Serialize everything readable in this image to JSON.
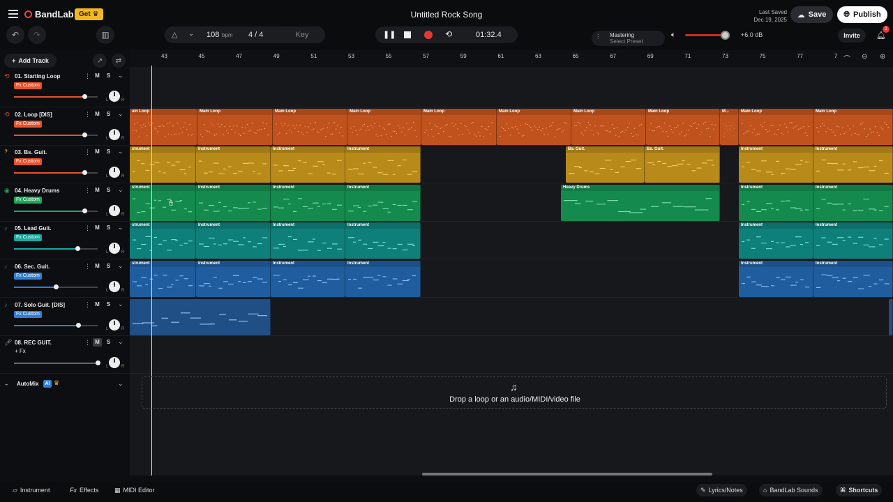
{
  "header": {
    "app_name": "BandLab",
    "get_label": "Get",
    "song_title": "Untitled Rock Song",
    "last_saved_label": "Last Saved",
    "last_saved_date": "Dec 19, 2025",
    "save_label": "Save",
    "publish_label": "Publish"
  },
  "toolbar": {
    "tempo": "108",
    "tempo_unit": "bpm",
    "time_signature": "4 / 4",
    "key_label": "Key",
    "time_display": "01:32.4",
    "mastering_label": "Mastering",
    "mastering_preset": "Select Preset",
    "volume_db": "+6.0 dB",
    "invite_label": "Invite",
    "notification_count": "1",
    "record_color": "#e53935"
  },
  "track_panel": {
    "add_track_label": "Add Track",
    "mute_label": "M",
    "solo_label": "S",
    "knob_left": "L",
    "knob_right": "R",
    "automix_label": "AutoMix",
    "automix_badge": "AI"
  },
  "tracks": [
    {
      "name": "01. Starting Loop",
      "fx": "Fx Custom",
      "fx_color": "#e8522b",
      "icon_color": "#e8522b",
      "volume": 0.7
    },
    {
      "name": "02. Loop [DIS]",
      "fx": "Fx Custom",
      "fx_color": "#e8522b",
      "icon_color": "#e8522b",
      "volume": 0.7
    },
    {
      "name": "03. Bs. Guit.",
      "fx": "Fx Custom",
      "fx_color": "#e8522b",
      "icon_color": "#e0a020",
      "volume": 0.7
    },
    {
      "name": "04. Heavy Drums",
      "fx": "Fx Custom",
      "fx_color": "#1fa85a",
      "icon_color": "#1fa85a",
      "volume": 0.7
    },
    {
      "name": "05. Lead Guit.",
      "fx": "Fx Custom",
      "fx_color": "#17a9a0",
      "icon_color": "#17a9a0",
      "volume": 0.63
    },
    {
      "name": "06. Sec. Guit.",
      "fx": "Fx Custom",
      "fx_color": "#2f7fd6",
      "icon_color": "#2f7fd6",
      "volume": 0.42
    },
    {
      "name": "07. Solo Guit. [DIS]",
      "fx": "Fx Custom",
      "fx_color": "#2f7fd6",
      "icon_color": "#2f7fd6",
      "volume": 0.64
    },
    {
      "name": "08. REC GUIT.",
      "fx": "+ Fx",
      "fx_color": "",
      "icon_color": "#aaaaaa",
      "volume": 1.0
    }
  ],
  "ruler": {
    "bars": [
      "43",
      "45",
      "47",
      "49",
      "51",
      "53",
      "55",
      "57",
      "59",
      "61",
      "63",
      "65",
      "67",
      "69",
      "71",
      "73",
      "75",
      "77",
      "7"
    ]
  },
  "clips": {
    "loop_label": "Main Loop",
    "loop_label_short": "M...",
    "instrument_label": "Instrument",
    "instrument_label_cut": "strument",
    "bass_label": "Bs. Guit.",
    "drums_label": "Heavy Drums",
    "loop_cut_label": "ain Loop"
  },
  "colors": {
    "loop": "#c0521d",
    "bass": "#b78a1a",
    "drums": "#148a4e",
    "lead": "#0f7f7a",
    "sec": "#1f5d9e",
    "solo": "#1f4f85"
  },
  "drop": {
    "text": "Drop a loop or an audio/MIDI/video file"
  },
  "bottom": {
    "instrument": "Instrument",
    "effects": "Effects",
    "midi_editor": "MIDI Editor",
    "lyrics": "Lyrics/Notes",
    "sounds": "BandLab Sounds",
    "shortcuts": "Shortcuts"
  }
}
